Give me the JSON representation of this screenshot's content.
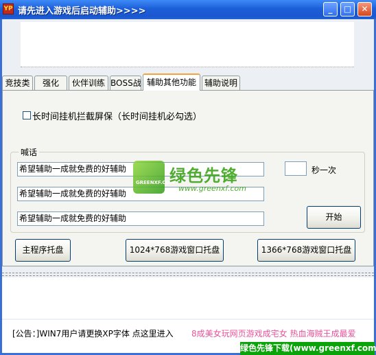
{
  "window": {
    "title": "请先进入游戏后启动辅助>>>>",
    "icon_text": "YP",
    "controls": {
      "minimize": "_",
      "maximize": "□",
      "close": "✕"
    }
  },
  "tabs": [
    {
      "label": "竞技类",
      "active": false
    },
    {
      "label": "强化",
      "active": false
    },
    {
      "label": "伙伴训练",
      "active": false
    },
    {
      "label": "BOSS战",
      "active": false
    },
    {
      "label": "辅助其他功能",
      "active": true
    },
    {
      "label": "辅助说明",
      "active": false
    }
  ],
  "panel": {
    "screensaver_checkbox": {
      "label": "长时间挂机拦截屏保（长时间挂机必勾选）",
      "checked": false
    },
    "shout_group": {
      "label": "喊话",
      "messages": [
        "希望辅助一成就免费的好辅助",
        "希望辅助一成就免费的好辅助",
        "希望辅助一成就免费的好辅助"
      ],
      "interval_value": "",
      "interval_unit": "秒一次",
      "start_button": "开始"
    },
    "tray_buttons": {
      "main": "主程序托盘",
      "tray_1024": "1024*768游戏窗口托盘",
      "tray_1366": "1366*768游戏窗口托盘"
    }
  },
  "notice": {
    "text": "[公告：]WIN7用户请更换XP字体 点这里进入",
    "marquee": "8成美女玩网页游戏成宅女 热血海贼王成最爱"
  },
  "watermark": {
    "logo_text": "GREENXF.COM",
    "name": "绿色先锋",
    "url": "www.greenxf.com",
    "footer": "绿色先锋下载(www.greenxf.com)"
  },
  "colors": {
    "titlebar": "#1c5fd9",
    "active_tab_accent": "#f3a33b",
    "marquee": "#e8539a",
    "watermark_green": "#3ea51c"
  }
}
